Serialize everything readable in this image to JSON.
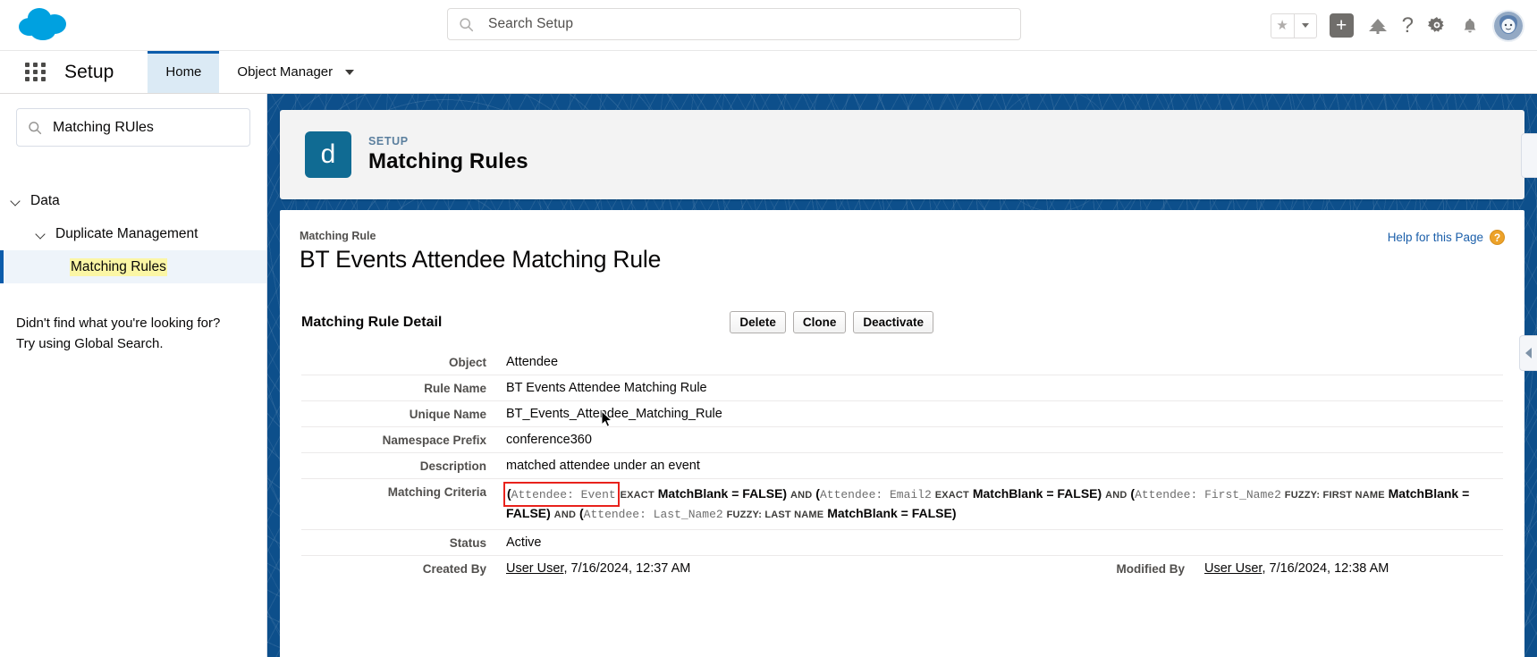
{
  "header": {
    "logo": "salesforce-cloud-logo",
    "search": {
      "placeholder": "Search Setup",
      "icon": "search-icon",
      "value": ""
    },
    "icons": {
      "favorites": "star-icon",
      "favorites_caret": "chevron-down-icon",
      "add": "plus-icon",
      "app_launcher_alt": "tree-icon",
      "help": "question-mark-icon",
      "setup_gear": "gear-icon",
      "notifications": "bell-icon",
      "avatar": "user-avatar"
    }
  },
  "setupbar": {
    "waffle": "app-launcher-icon",
    "title": "Setup",
    "tabs": [
      {
        "label": "Home",
        "active": true,
        "caret": false
      },
      {
        "label": "Object Manager",
        "active": false,
        "caret": true
      }
    ]
  },
  "sidebar": {
    "search": {
      "value": "Matching RUles",
      "icon": "search-icon"
    },
    "tree": [
      {
        "label": "Data",
        "level": 0,
        "expanded": true,
        "selected": false
      },
      {
        "label": "Duplicate Management",
        "level": 1,
        "expanded": true,
        "selected": false
      },
      {
        "label": "Matching Rules",
        "level": 2,
        "expanded": false,
        "selected": true,
        "highlight": true
      }
    ],
    "note_line1": "Didn't find what you're looking for?",
    "note_line2": "Try using Global Search."
  },
  "page_header": {
    "icon_letter": "d",
    "eyebrow": "SETUP",
    "title": "Matching Rules"
  },
  "detail": {
    "help_link": "Help for this Page",
    "help_icon": "help-question-icon",
    "record_eyebrow": "Matching Rule",
    "record_title": "BT Events Attendee Matching Rule",
    "section_title": "Matching Rule Detail",
    "buttons": [
      {
        "label": "Delete"
      },
      {
        "label": "Clone"
      },
      {
        "label": "Deactivate"
      }
    ],
    "fields": {
      "object_label": "Object",
      "object_value": "Attendee",
      "rule_name_label": "Rule Name",
      "rule_name_value": "BT Events Attendee Matching Rule",
      "unique_name_label": "Unique Name",
      "unique_name_value": "BT_Events_Attendee_Matching_Rule",
      "namespace_label": "Namespace Prefix",
      "namespace_value": "conference360",
      "description_label": "Description",
      "description_value": "matched attendee under an event",
      "criteria_label": "Matching Criteria",
      "status_label": "Status",
      "status_value": "Active",
      "created_by_label": "Created By",
      "created_by_user": "User User",
      "created_by_rest": ", 7/16/2024, 12:37 AM",
      "modified_by_label": "Modified By",
      "modified_by_user": "User User",
      "modified_by_rest": ", 7/16/2024, 12:38 AM"
    },
    "criteria": {
      "p1_open": "(",
      "p1_field": "Attendee: Event",
      "p1_op": "EXACT",
      "p1_tail": "MatchBlank = FALSE)",
      "and1": "AND",
      "p2_open": "(",
      "p2_field": "Attendee: Email2",
      "p2_op": "EXACT",
      "p2_tail": "MatchBlank = FALSE)",
      "and2": "AND",
      "p3_open": "(",
      "p3_field": "Attendee: First_Name2",
      "p3_op": "FUZZY: FIRST NAME",
      "p3_tail": "MatchBlank = FALSE)",
      "and3": "AND",
      "p4_open": "(",
      "p4_field": "Attendee: Last_Name2",
      "p4_op": "FUZZY: LAST NAME",
      "p4_tail": "MatchBlank = FALSE)"
    },
    "annotation": {
      "target": "Attendee: Event",
      "color": "#e8221c"
    }
  },
  "colors": {
    "brand_blue": "#0d4f8b",
    "accent_tab": "#0b5cab",
    "object_icon": "#106b93",
    "highlight_yellow": "#fbf6a5",
    "annotation_red": "#e8221c",
    "help_orange": "#eda229"
  }
}
